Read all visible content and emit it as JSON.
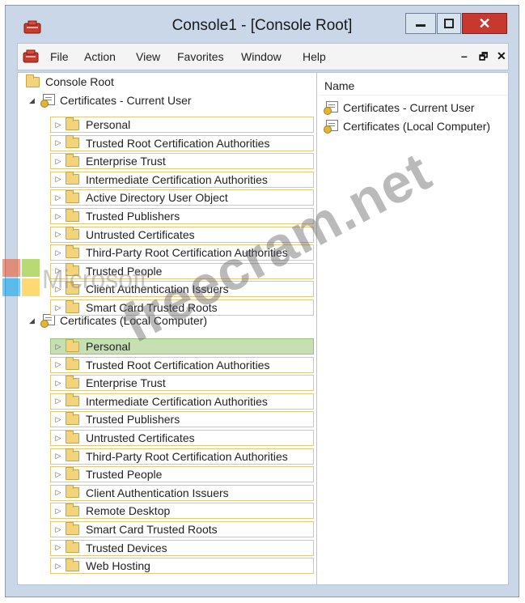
{
  "window": {
    "title": "Console1 - [Console Root]",
    "controls": {
      "minimize": "–",
      "maximize": "□",
      "close": "✕"
    }
  },
  "menu": {
    "items": [
      "File",
      "Action",
      "View",
      "Favorites",
      "Window",
      "Help"
    ],
    "mdi_controls": [
      "–",
      "🗗",
      "✕"
    ]
  },
  "tree": {
    "root": "Console Root",
    "nodes": [
      {
        "label": "Certificates - Current User",
        "children": [
          "Personal",
          "Trusted Root Certification Authorities",
          "Enterprise Trust",
          "Intermediate Certification Authorities",
          "Active Directory User Object",
          "Trusted Publishers",
          "Untrusted Certificates",
          "Third-Party Root Certification Authorities",
          "Trusted People",
          "Client Authentication Issuers",
          "Smart Card Trusted Roots"
        ]
      },
      {
        "label": "Certificates (Local Computer)",
        "selected_child": "Personal",
        "children": [
          "Personal",
          "Trusted Root Certification Authorities",
          "Enterprise Trust",
          "Intermediate Certification Authorities",
          "Trusted Publishers",
          "Untrusted Certificates",
          "Third-Party Root Certification Authorities",
          "Trusted People",
          "Client Authentication Issuers",
          "Remote Desktop",
          "Smart Card Trusted Roots",
          "Trusted Devices",
          "Web Hosting"
        ]
      }
    ]
  },
  "right_pane": {
    "column_header": "Name",
    "items": [
      "Certificates - Current User",
      "Certificates (Local Computer)"
    ]
  },
  "watermark": {
    "text": "freecram.net",
    "logo_text": "Microsoft"
  },
  "colors": {
    "selected": "#c6e0b4",
    "folder": "#f3d37b",
    "child_border": "#e5c77a",
    "close": "#c7382f"
  }
}
